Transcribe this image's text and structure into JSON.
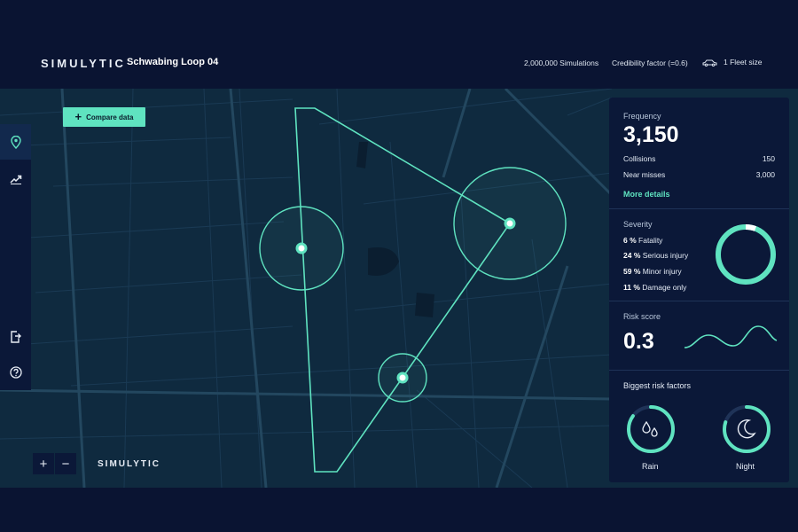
{
  "header": {
    "brand": "SIMULYTIC",
    "project": "Schwabing Loop 04",
    "simulations": "2,000,000 Simulations",
    "credibility": "Credibility factor (=0.6)",
    "fleet": "1 Fleet size"
  },
  "toolbar": {
    "compare_label": "Compare data",
    "zoom_in": "+",
    "zoom_out": "−"
  },
  "map": {
    "brand": "SIMULYTIC"
  },
  "frequency": {
    "title": "Frequency",
    "value": "3,150",
    "rows": [
      {
        "label": "Collisions",
        "value": "150"
      },
      {
        "label": "Near misses",
        "value": "3,000"
      }
    ],
    "more": "More details"
  },
  "severity": {
    "title": "Severity",
    "items": [
      {
        "pct": "6 %",
        "label": "Fatality"
      },
      {
        "pct": "24 %",
        "label": "Serious injury"
      },
      {
        "pct": "59 %",
        "label": "Minor injury"
      },
      {
        "pct": "11 %",
        "label": "Damage only"
      }
    ]
  },
  "risk_score": {
    "title": "Risk score",
    "value": "0.3"
  },
  "risk_factors": {
    "title": "Biggest risk factors",
    "items": [
      {
        "label": "Rain",
        "icon": "raindrops-icon",
        "level": 0.85
      },
      {
        "label": "Night",
        "icon": "moon-icon",
        "level": 0.8
      }
    ]
  },
  "colors": {
    "accent": "#5fe3c0",
    "background": "#0a1432",
    "panel": "#0b1838",
    "map": "#0f2a3f"
  }
}
